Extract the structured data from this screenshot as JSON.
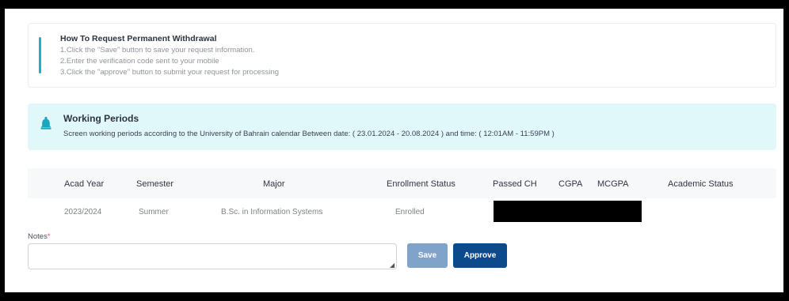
{
  "howto": {
    "title": "How To Request Permanent Withdrawal",
    "steps": [
      "1.Click the \"Save\" button to save your request information.",
      "2.Enter the verification code sent to your mobile",
      "3.Click the \"approve\" button to submit your request for processing"
    ]
  },
  "working_periods": {
    "icon": "bell-icon",
    "title": "Working Periods",
    "text": "Screen working periods according to the University of Bahrain calendar Between date: ( 23.01.2024 - 20.08.2024 ) and time: ( 12:01AM - 11:59PM )"
  },
  "table": {
    "headers": [
      "Acad Year",
      "Semester",
      "Major",
      "Enrollment Status",
      "Passed CH",
      "CGPA",
      "MCGPA",
      "Academic Status"
    ],
    "rows": [
      [
        "2023/2024",
        "Summer",
        "B.Sc. in Information Systems",
        "Enrolled",
        "",
        "",
        "",
        ""
      ]
    ]
  },
  "form": {
    "notes_label": "Notes",
    "required_mark": "*",
    "notes_value": "",
    "save_label": "Save",
    "approve_label": "Approve"
  },
  "colors": {
    "accent": "#17b3c9",
    "info_background": "#e1f8fb",
    "primary_button": "#0d4a8c",
    "disabled_button": "#7fa3c9"
  }
}
